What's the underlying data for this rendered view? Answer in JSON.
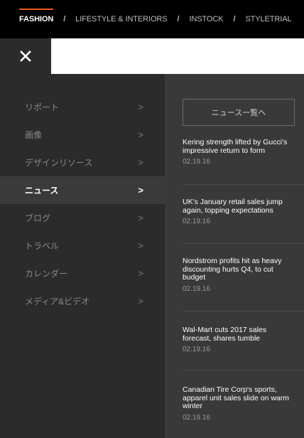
{
  "topnav": {
    "items": [
      "FASHION",
      "LIFESTYLE & INTERIORS",
      "INSTOCK",
      "STYLETRIAL"
    ],
    "separator": "/",
    "accent_color": "#e8582a"
  },
  "close_icon": "close-icon",
  "menu": {
    "items": [
      {
        "label": "リポート",
        "chevron": ">"
      },
      {
        "label": "画像",
        "chevron": ">"
      },
      {
        "label": "デザインリソース",
        "chevron": ">"
      },
      {
        "label": "ニュース",
        "chevron": ">"
      },
      {
        "label": "ブログ",
        "chevron": ">"
      },
      {
        "label": "トラベル",
        "chevron": ">"
      },
      {
        "label": "カレンダー",
        "chevron": ">"
      },
      {
        "label": "メディア&ビデオ",
        "chevron": ">"
      }
    ],
    "active_item": "ニュース"
  },
  "news": {
    "all_news_button": "ニュース一覧へ",
    "articles": [
      {
        "headline": "Kering strength lifted by Gucci's impressive return to form",
        "date": "02.19.16"
      },
      {
        "headline": "UK's January retail sales jump again, topping expectations",
        "date": "02.19.16"
      },
      {
        "headline": "Nordstrom profits hit as heavy discounting hurts Q4, to cut budget",
        "date": "02.19.16"
      },
      {
        "headline": "Wal-Mart cuts 2017 sales forecast, shares tumble",
        "date": "02.19.16"
      },
      {
        "headline": "Canadian Tire Corp's sports, apparel unit sales slide on warm winter",
        "date": "02.19.16"
      }
    ]
  }
}
